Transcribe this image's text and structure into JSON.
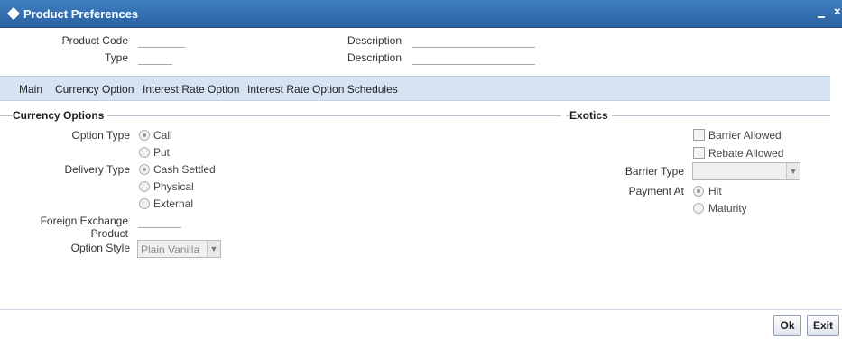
{
  "window": {
    "title": "Product Preferences",
    "minimize_icon": "minimize-icon",
    "close_icon": "close-icon",
    "close_glyph": "×"
  },
  "header": {
    "product_code_label": "Product Code",
    "type_label": "Type",
    "description_label_1": "Description",
    "description_label_2": "Description",
    "product_code_value": "",
    "type_value": "",
    "description_value_1": "",
    "description_value_2": ""
  },
  "tabs": [
    {
      "label": "Main"
    },
    {
      "label": "Currency Option"
    },
    {
      "label": "Interest Rate Option"
    },
    {
      "label": "Interest Rate Option Schedules"
    }
  ],
  "currency_options": {
    "section_title": "Currency Options",
    "option_type_label": "Option Type",
    "option_type_options": [
      "Call",
      "Put"
    ],
    "option_type_selected": "Call",
    "delivery_type_label": "Delivery Type",
    "delivery_type_options": [
      "Cash Settled",
      "Physical",
      "External"
    ],
    "delivery_type_selected": "Cash Settled",
    "fx_product_label_line1": "Foreign Exchange",
    "fx_product_label_line2": "Product",
    "fx_product_value": "",
    "option_style_label": "Option Style",
    "option_style_value": "Plain Vanilla"
  },
  "exotics": {
    "section_title": "Exotics",
    "barrier_allowed_label": "Barrier Allowed",
    "barrier_allowed_checked": false,
    "rebate_allowed_label": "Rebate Allowed",
    "rebate_allowed_checked": false,
    "barrier_type_label": "Barrier Type",
    "barrier_type_value": "",
    "payment_at_label": "Payment At",
    "payment_at_options": [
      "Hit",
      "Maturity"
    ],
    "payment_at_selected": "Hit"
  },
  "footer": {
    "ok_label": "Ok",
    "exit_label": "Exit"
  },
  "colors": {
    "titlebar": "#2f6db1",
    "tabbar": "#d6e3f3",
    "section_line": "#b9c3cf"
  }
}
